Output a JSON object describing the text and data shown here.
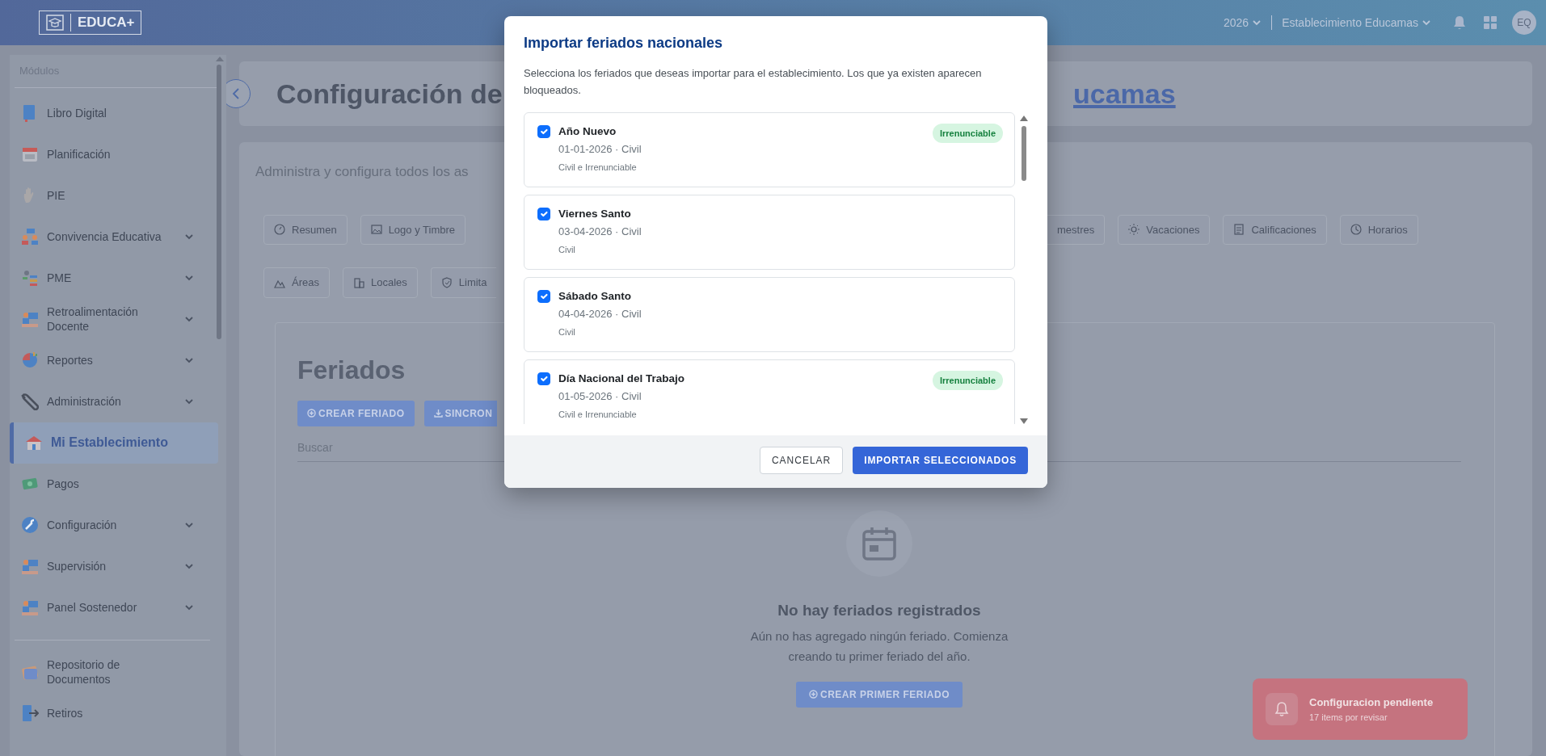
{
  "topbar": {
    "logo_text": "EDUCA+",
    "year": "2026",
    "school": "Establecimiento Educamas",
    "avatar": "EQ"
  },
  "sidebar": {
    "heading": "Módulos",
    "items": [
      {
        "label": "Libro Digital",
        "has_submenu": false,
        "selected": false
      },
      {
        "label": "Planificación",
        "has_submenu": false,
        "selected": false
      },
      {
        "label": "PIE",
        "has_submenu": false,
        "selected": false
      },
      {
        "label": "Convivencia Educativa",
        "has_submenu": true,
        "selected": false
      },
      {
        "label": "PME",
        "has_submenu": true,
        "selected": false
      },
      {
        "label": "Retroalimentación Docente",
        "has_submenu": true,
        "selected": false
      },
      {
        "label": "Reportes",
        "has_submenu": true,
        "selected": false
      },
      {
        "label": "Administración",
        "has_submenu": true,
        "selected": false
      },
      {
        "label": "Mi Establecimiento",
        "has_submenu": false,
        "selected": true
      },
      {
        "label": "Pagos",
        "has_submenu": false,
        "selected": false
      },
      {
        "label": "Configuración",
        "has_submenu": true,
        "selected": false
      },
      {
        "label": "Supervisión",
        "has_submenu": true,
        "selected": false
      },
      {
        "label": "Panel Sostenedor",
        "has_submenu": true,
        "selected": false
      }
    ],
    "footer_items": [
      {
        "label": "Repositorio de Documentos",
        "selected": false
      },
      {
        "label": "Retiros",
        "selected": false
      }
    ]
  },
  "header": {
    "title_start": "Configuración de",
    "title_end": "ucamas"
  },
  "description": "Administra y configura todos los as",
  "tabs_left": [
    {
      "label": "Resumen",
      "selected": false
    },
    {
      "label": "Logo y Timbre",
      "selected": false
    }
  ],
  "tabs_right": [
    {
      "label": "mestres",
      "selected": false
    },
    {
      "label": "Vacaciones",
      "selected": false
    },
    {
      "label": "Calificaciones",
      "selected": false
    },
    {
      "label": "Horarios",
      "selected": false
    }
  ],
  "tabs_row_2": [
    {
      "label": "Áreas",
      "selected": false
    },
    {
      "label": "Locales",
      "selected": false
    },
    {
      "label": "Limita",
      "selected": false
    }
  ],
  "feriados": {
    "heading": "Feriados",
    "buttons": [
      "CREAR FERIADO",
      "SINCRON"
    ],
    "search_placeholder": "Buscar",
    "empty": {
      "title": "No hay feriados registrados",
      "text": "Aún no has agregado ningún feriado. Comienza creando tu primer feriado del año.",
      "button": "CREAR PRIMER FERIADO"
    }
  },
  "toast": {
    "title": "Configuracion pendiente",
    "text": "17 items por revisar"
  },
  "modal": {
    "title": "Importar feriados nacionales",
    "description": "Selecciona los feriados que deseas importar para el establecimiento. Los que ya existen aparecen bloqueados.",
    "holidays": [
      {
        "name": "Año Nuevo",
        "date": "01-01-2026 · Civil",
        "detail": "Civil e Irrenunciable",
        "badge": "Irrenunciable",
        "checked": true
      },
      {
        "name": "Viernes Santo",
        "date": "03-04-2026 · Civil",
        "detail": "Civil",
        "checked": true
      },
      {
        "name": "Sábado Santo",
        "date": "04-04-2026 · Civil",
        "detail": "Civil",
        "checked": true
      },
      {
        "name": "Día Nacional del Trabajo",
        "date": "01-05-2026 · Civil",
        "detail": "Civil e Irrenunciable",
        "badge": "Irrenunciable",
        "checked": true
      }
    ],
    "cancel": "CANCELAR",
    "confirm": "IMPORTAR SELECCIONADOS"
  }
}
